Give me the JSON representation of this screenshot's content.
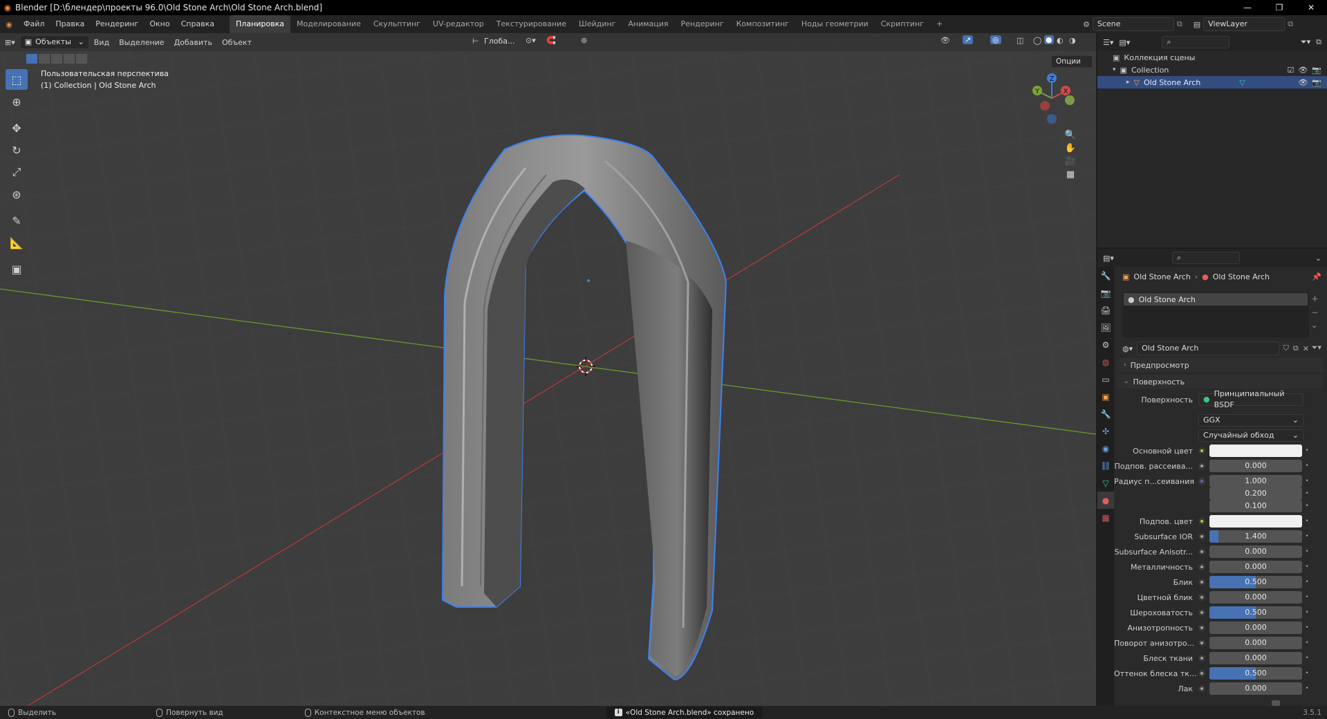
{
  "titlebar": {
    "title": "Blender [D:\\блендер\\проекты 96.0\\Old Stone Arch\\Old Stone Arch.blend]",
    "minimize": "—",
    "maximize": "❐",
    "close": "✕"
  },
  "menu": [
    "Файл",
    "Правка",
    "Рендеринг",
    "Окно",
    "Справка"
  ],
  "workspaces": [
    "Планировка",
    "Моделирование",
    "Скульптинг",
    "UV-редактор",
    "Текстурирование",
    "Шейдинг",
    "Анимация",
    "Рендеринг",
    "Композитинг",
    "Ноды геометрии",
    "Скриптинг"
  ],
  "active_workspace": "Планировка",
  "add_workspace": "+",
  "scene": {
    "name": "Scene",
    "viewlayer": "ViewLayer"
  },
  "viewport": {
    "mode": "Объекты",
    "menus": [
      "Вид",
      "Выделение",
      "Добавить",
      "Объект"
    ],
    "orientation": "Глоба...",
    "options": "Опции",
    "perspective_label": "Пользовательская перспектива",
    "collection_label": "(1) Collection | Old Stone Arch",
    "gizmo_axes": {
      "z": "Z",
      "y": "Y",
      "x": "X"
    }
  },
  "outliner": {
    "root": "Коллекция сцены",
    "collection": "Collection",
    "object": "Old Stone Arch"
  },
  "properties": {
    "breadcrumb_object": "Old Stone Arch",
    "breadcrumb_material": "Old Stone Arch",
    "slot_name": "Old Stone Arch",
    "material_name": "Old Stone Arch",
    "preview_panel": "Предпросмотр",
    "surface_panel": "Поверхность",
    "surface_label": "Поверхность",
    "surface_value": "Принципиальный BSDF",
    "distribution": "GGX",
    "subsurface_method": "Случайный обход",
    "rows": [
      {
        "label": "Основной цвет",
        "value": "",
        "type": "color",
        "dot": "yellow"
      },
      {
        "label": "Подпов. рассеива...",
        "value": "0.000",
        "fill": 0,
        "dot": "gray"
      },
      {
        "label": "Радиус п...сеивания",
        "value": "1.000",
        "fill": 0,
        "dot": "blue"
      },
      {
        "label": "",
        "value": "0.200",
        "fill": 0,
        "dot": "none"
      },
      {
        "label": "",
        "value": "0.100",
        "fill": 0,
        "dot": "none"
      },
      {
        "label": "Подпов. цвет",
        "value": "",
        "type": "color",
        "dot": "yellow"
      },
      {
        "label": "Subsurface IOR",
        "value": "1.400",
        "fill": 0.1,
        "dot": "gray"
      },
      {
        "label": "Subsurface Anisotr...",
        "value": "0.000",
        "fill": 0,
        "dot": "gray"
      },
      {
        "label": "Металличность",
        "value": "0.000",
        "fill": 0,
        "dot": "gray"
      },
      {
        "label": "Блик",
        "value": "0.500",
        "fill": 0.5,
        "dot": "gray"
      },
      {
        "label": "Цветной блик",
        "value": "0.000",
        "fill": 0,
        "dot": "gray"
      },
      {
        "label": "Шероховатость",
        "value": "0.500",
        "fill": 0.5,
        "dot": "gray"
      },
      {
        "label": "Анизотропность",
        "value": "0.000",
        "fill": 0,
        "dot": "gray"
      },
      {
        "label": "Поворот анизотро...",
        "value": "0.000",
        "fill": 0,
        "dot": "gray"
      },
      {
        "label": "Блеск ткани",
        "value": "0.000",
        "fill": 0,
        "dot": "gray"
      },
      {
        "label": "Оттенок блеска тк...",
        "value": "0.500",
        "fill": 0.5,
        "dot": "gray"
      },
      {
        "label": "Лак",
        "value": "0.000",
        "fill": 0,
        "dot": "gray"
      }
    ]
  },
  "statusbar": {
    "select": "Выделить",
    "rotate": "Повернуть вид",
    "context": "Контекстное меню объектов",
    "message": "«Old Stone Arch.blend» сохранено",
    "version": "3.5.1"
  },
  "colors": {
    "accent": "#4772b3",
    "selection_outline": "#3b82f6",
    "x_axis": "#b33a3a",
    "y_axis": "#6a9a2a"
  }
}
